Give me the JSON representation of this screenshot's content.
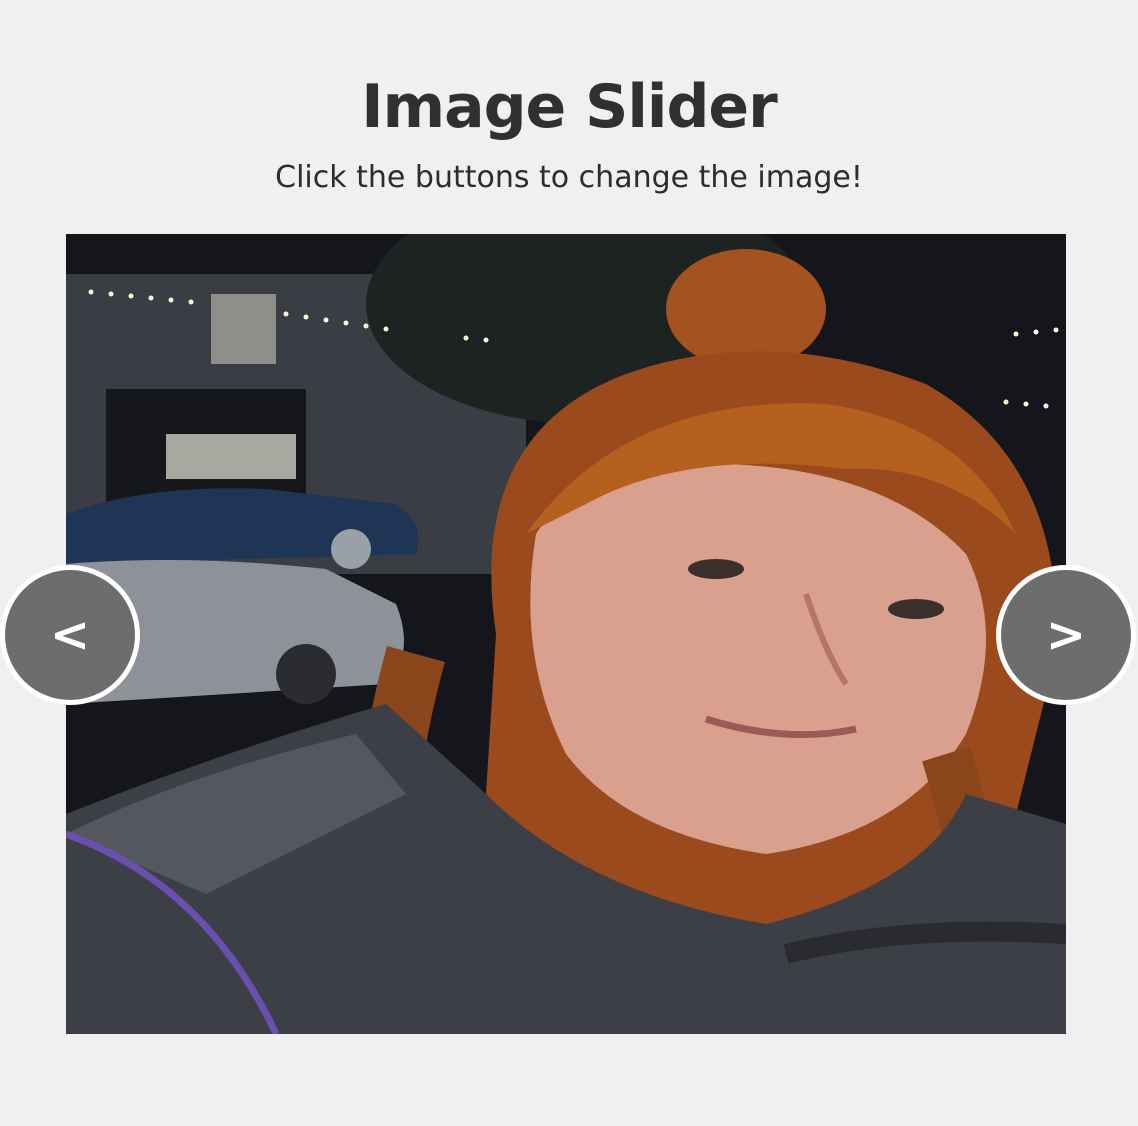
{
  "header": {
    "title": "Image Slider",
    "subtitle": "Click the buttons to change the image!"
  },
  "slider": {
    "image_alt": "",
    "prev_label": "<",
    "next_label": ">"
  },
  "colors": {
    "background": "#f0f0f0",
    "button_fill": "#6d6d6d",
    "button_border": "#ffffff",
    "title_text": "#303030"
  }
}
